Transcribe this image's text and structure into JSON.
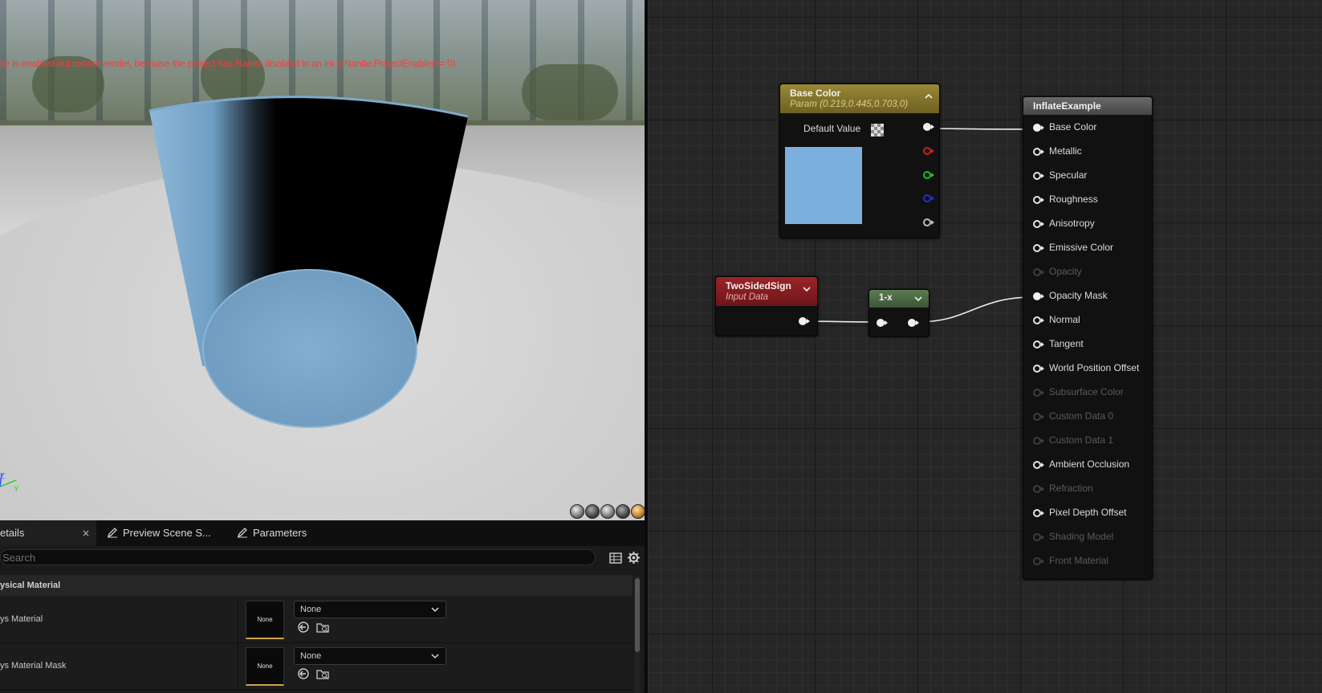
{
  "viewport": {
    "warning": "ite is enabled but cannot render, because the project has Nanite disabled in an ini (r.Nanite.ProjectEnabled = 0)",
    "axis_z": "Z",
    "axis_y": "Y"
  },
  "details_panel": {
    "tabs": [
      {
        "label": "etails",
        "icon": "",
        "active": true
      },
      {
        "label": "Preview Scene S...",
        "icon": "pencil-icon",
        "active": false
      },
      {
        "label": "Parameters",
        "icon": "pencil-icon",
        "active": false
      }
    ],
    "close_glyph": "×",
    "search_placeholder": "Search",
    "section_title": "ysical Material",
    "properties": [
      {
        "label": "ys Material",
        "thumb": "None",
        "value": "None"
      },
      {
        "label": "ys Material Mask",
        "thumb": "None",
        "value": "None"
      }
    ]
  },
  "graph": {
    "base_color_node": {
      "title": "Base Color",
      "subtitle": "Param (0.219,0.445,0.703,0)",
      "default_value_label": "Default Value",
      "swatch_color": "#7eb0df"
    },
    "two_sided_node": {
      "title": "TwoSidedSign",
      "subtitle": "Input Data"
    },
    "one_minus_node": {
      "title": "1-x"
    },
    "result_node": {
      "title": "InflateExample",
      "pins": [
        {
          "label": "Base Color",
          "state": "connected"
        },
        {
          "label": "Metallic",
          "state": "enabled"
        },
        {
          "label": "Specular",
          "state": "enabled"
        },
        {
          "label": "Roughness",
          "state": "enabled"
        },
        {
          "label": "Anisotropy",
          "state": "enabled"
        },
        {
          "label": "Emissive Color",
          "state": "enabled"
        },
        {
          "label": "Opacity",
          "state": "disabled"
        },
        {
          "label": "Opacity Mask",
          "state": "connected"
        },
        {
          "label": "Normal",
          "state": "enabled"
        },
        {
          "label": "Tangent",
          "state": "enabled"
        },
        {
          "label": "World Position Offset",
          "state": "enabled"
        },
        {
          "label": "Subsurface Color",
          "state": "disabled"
        },
        {
          "label": "Custom Data 0",
          "state": "disabled"
        },
        {
          "label": "Custom Data 1",
          "state": "disabled"
        },
        {
          "label": "Ambient Occlusion",
          "state": "enabled"
        },
        {
          "label": "Refraction",
          "state": "disabled"
        },
        {
          "label": "Pixel Depth Offset",
          "state": "enabled"
        },
        {
          "label": "Shading Model",
          "state": "disabled"
        },
        {
          "label": "Front Material",
          "state": "disabled"
        }
      ]
    },
    "colors": {
      "base_color_header": "#8a7a2e",
      "two_sided_header": "#8b1e22",
      "one_minus_header": "#4d6b45",
      "result_header": "#5a5a5a",
      "pin_red": "#d02020",
      "pin_green": "#20c020",
      "pin_blue": "#2030d0"
    }
  }
}
